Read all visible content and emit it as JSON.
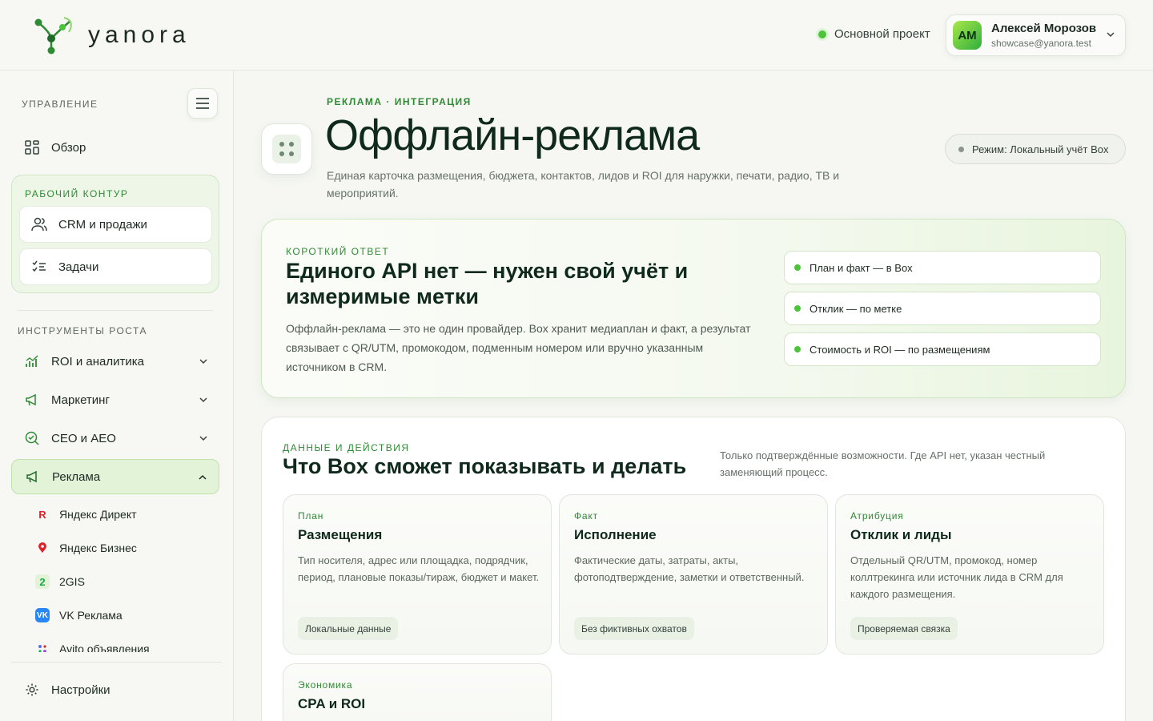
{
  "header": {
    "brand": "yanora",
    "project": "Основной проект",
    "user": {
      "initials": "АМ",
      "name": "Алексей Морозов",
      "email": "showcase@yanora.test"
    }
  },
  "sidebar": {
    "manage_label": "УПРАВЛЕНИЕ",
    "overview": "Обзор",
    "work_label": "РАБОЧИЙ КОНТУР",
    "work_items": [
      "CRM и продажи",
      "Задачи"
    ],
    "growth_label": "ИНСТРУМЕНТЫ РОСТА",
    "growth_items": [
      "ROI и аналитика",
      "Маркетинг",
      "СЕО и AEO"
    ],
    "ads": "Реклама",
    "ad_sub": [
      "Яндекс Директ",
      "Яндекс Бизнес",
      "2GIS",
      "VK Реклама",
      "Avito объявления"
    ],
    "settings": "Настройки"
  },
  "page": {
    "kicker": "РЕКЛАМА · ИНТЕГРАЦИЯ",
    "title": "Оффлайн-реклама",
    "description": "Единая карточка размещения, бюджета, контактов, лидов и ROI для наружки, печати, радио, ТВ и мероприятий.",
    "mode": "Режим: Локальный учёт Box"
  },
  "answer": {
    "kicker": "КОРОТКИЙ ОТВЕТ",
    "title": "Единого API нет — нужен свой учёт и измеримые метки",
    "text": "Оффлайн-реклама — это не один провайдер. Box хранит медиаплан и факт, а результат связывает с QR/UTM, промокодом, подменным номером или вручно указанным источником в CRM.",
    "points": [
      "План и факт — в Box",
      "Отклик — по метке",
      "Стоимость и ROI — по размещениям"
    ]
  },
  "data": {
    "kicker": "ДАННЫЕ И ДЕЙСТВИЯ",
    "title": "Что Box сможет показывать и делать",
    "note": "Только подтверждённые возможности. Где API нет, указан честный заменяющий процесс.",
    "cards": [
      {
        "kicker": "План",
        "title": "Размещения",
        "text": "Тип носителя, адрес или площадка, подрядчик, период, плановые показы/тираж, бюджет и макет.",
        "badge": "Локальные данные"
      },
      {
        "kicker": "Факт",
        "title": "Исполнение",
        "text": "Фактические даты, затраты, акты, фотоподтверждение, заметки и ответственный.",
        "badge": "Без фиктивных охватов"
      },
      {
        "kicker": "Атрибуция",
        "title": "Отклик и лиды",
        "text": "Отдельный QR/UTM, промокод, номер коллтрекинга или источник лида в CRM для каждого размещения.",
        "badge": "Проверяемая связка"
      },
      {
        "kicker": "Экономика",
        "title": "CPA и ROI",
        "text": "",
        "badge": ""
      }
    ]
  }
}
